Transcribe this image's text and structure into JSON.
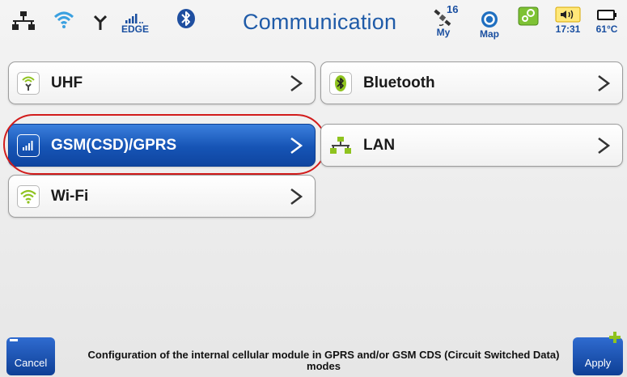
{
  "status_bar": {
    "title": "Communication",
    "cellular_label": "EDGE",
    "satellites_count": "16",
    "satellites_label": "My",
    "map_label": "Map",
    "time": "17:31",
    "temperature": "61°C"
  },
  "menu": {
    "uhf": "UHF",
    "bluetooth": "Bluetooth",
    "gsm": "GSM(CSD)/GPRS",
    "lan": "LAN",
    "wifi": "Wi-Fi"
  },
  "bottom": {
    "cancel_label": "Cancel",
    "apply_label": "Apply",
    "description": "Configuration of the internal cellular  module in GPRS and/or GSM CDS (Circuit Switched Data) modes"
  },
  "colors": {
    "accent": "#1654b5",
    "title": "#1f5ba8",
    "highlight_ring": "#d21c1c",
    "icon_green": "#8fc31f"
  }
}
